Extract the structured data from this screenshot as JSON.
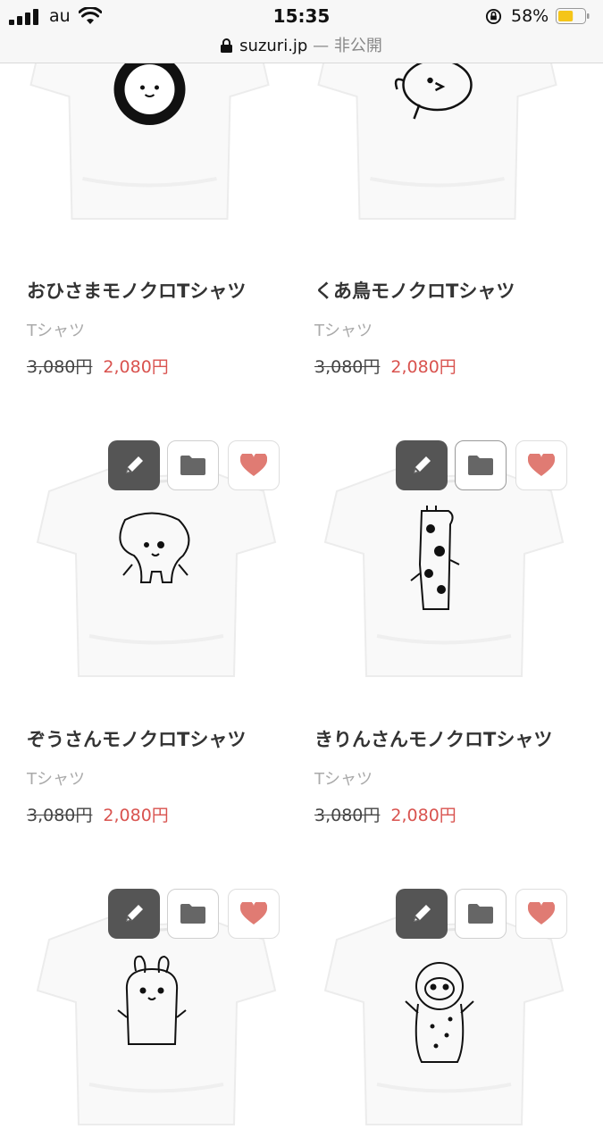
{
  "status_bar": {
    "carrier": "au",
    "time": "15:35",
    "battery_percent": "58%",
    "battery_level": 0.58,
    "url": "suzuri.jp",
    "visibility": "— 非公開"
  },
  "products": [
    {
      "title": "おひさまモノクロTシャツ",
      "category": "Tシャツ",
      "old_price": "3,080円",
      "price": "2,080円"
    },
    {
      "title": "くあ鳥モノクロTシャツ",
      "category": "Tシャツ",
      "old_price": "3,080円",
      "price": "2,080円"
    },
    {
      "title": "ぞうさんモノクロTシャツ",
      "category": "Tシャツ",
      "old_price": "3,080円",
      "price": "2,080円"
    },
    {
      "title": "きりんさんモノクロTシャツ",
      "category": "Tシャツ",
      "old_price": "3,080円",
      "price": "2,080円"
    }
  ],
  "icons": {
    "edit": "pencil-icon",
    "folder": "folder-icon",
    "like": "heart-icon"
  },
  "colors": {
    "sale_price": "#d9534f",
    "edit_button": "#555555",
    "heart": "#e07b73",
    "folder": "#666666"
  }
}
